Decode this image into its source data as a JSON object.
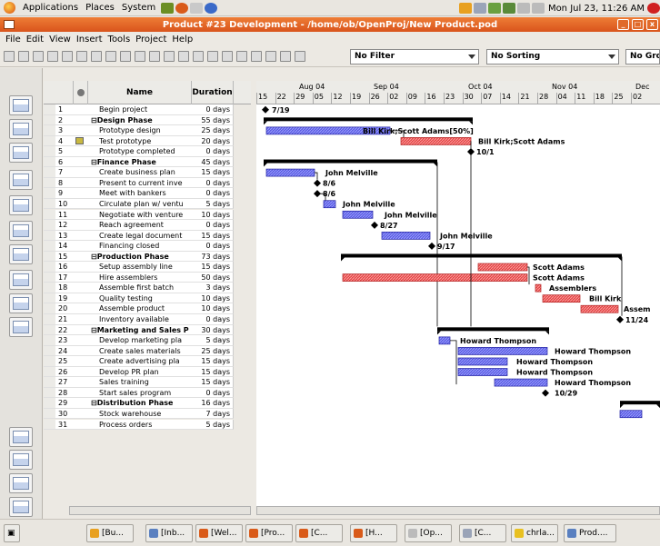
{
  "topbar": {
    "applications": "Applications",
    "places": "Places",
    "system": "System",
    "clock": "Mon Jul 23, 11:26 AM"
  },
  "window": {
    "title": "Product #23 Development - /home/ob/OpenProj/New Product.pod"
  },
  "menu": [
    "File",
    "Edit",
    "View",
    "Insert",
    "Tools",
    "Project",
    "Help"
  ],
  "toolbar": {
    "filter": "No Filter",
    "sorting": "No Sorting",
    "group": "No Grou"
  },
  "table": {
    "col_name": "Name",
    "col_duration": "Duration",
    "rows": [
      {
        "id": "1",
        "name": "Begin project",
        "dur": "0 days"
      },
      {
        "id": "2",
        "name": "⊟Design Phase",
        "dur": "55 days",
        "sum": true
      },
      {
        "id": "3",
        "name": "Prototype design",
        "dur": "25 days"
      },
      {
        "id": "4",
        "name": "Test prototype",
        "dur": "20 days",
        "note": true
      },
      {
        "id": "5",
        "name": "Prototype completed",
        "dur": "0 days"
      },
      {
        "id": "6",
        "name": "⊟Finance Phase",
        "dur": "45 days",
        "sum": true
      },
      {
        "id": "7",
        "name": "Create business plan",
        "dur": "15 days"
      },
      {
        "id": "8",
        "name": "Present to current inve",
        "dur": "0 days"
      },
      {
        "id": "9",
        "name": "Meet with bankers",
        "dur": "0 days"
      },
      {
        "id": "10",
        "name": "Circulate plan w/ ventu",
        "dur": "5 days"
      },
      {
        "id": "11",
        "name": "Negotiate with venture",
        "dur": "10 days"
      },
      {
        "id": "12",
        "name": "Reach agreement",
        "dur": "0 days"
      },
      {
        "id": "13",
        "name": "Create legal document",
        "dur": "15 days"
      },
      {
        "id": "14",
        "name": "Financing closed",
        "dur": "0 days"
      },
      {
        "id": "15",
        "name": "⊟Production Phase",
        "dur": "73 days",
        "sum": true
      },
      {
        "id": "16",
        "name": "Setup assembly line",
        "dur": "15 days"
      },
      {
        "id": "17",
        "name": "Hire assemblers",
        "dur": "50 days"
      },
      {
        "id": "18",
        "name": "Assemble first batch",
        "dur": "3 days"
      },
      {
        "id": "19",
        "name": "Quality testing",
        "dur": "10 days"
      },
      {
        "id": "20",
        "name": "Assemble product",
        "dur": "10 days"
      },
      {
        "id": "21",
        "name": "Inventory available",
        "dur": "0 days"
      },
      {
        "id": "22",
        "name": "⊟Marketing and Sales P",
        "dur": "30 days",
        "sum": true
      },
      {
        "id": "23",
        "name": "Develop marketing pla",
        "dur": "5 days"
      },
      {
        "id": "24",
        "name": "Create sales materials",
        "dur": "25 days"
      },
      {
        "id": "25",
        "name": "Create advertising pla",
        "dur": "15 days"
      },
      {
        "id": "26",
        "name": "Develop PR plan",
        "dur": "15 days"
      },
      {
        "id": "27",
        "name": "Sales training",
        "dur": "15 days"
      },
      {
        "id": "28",
        "name": "Start sales program",
        "dur": "0 days"
      },
      {
        "id": "29",
        "name": "⊟Distribution Phase",
        "dur": "16 days",
        "sum": true
      },
      {
        "id": "30",
        "name": "Stock warehouse",
        "dur": "7 days"
      },
      {
        "id": "31",
        "name": "Process orders",
        "dur": "5 days"
      }
    ]
  },
  "gantt": {
    "months": [
      {
        "label": "Aug 04"
      },
      {
        "label": "Sep 04"
      },
      {
        "label": "Oct 04"
      },
      {
        "label": "Nov 04"
      },
      {
        "label": "Dec"
      }
    ],
    "weeks": [
      "15",
      "22",
      "29",
      "05",
      "12",
      "19",
      "26",
      "02",
      "09",
      "16",
      "23",
      "30",
      "07",
      "14",
      "21",
      "28",
      "04",
      "11",
      "18",
      "25",
      "02"
    ],
    "labels": {
      "m1": "7/19",
      "r3": "Bill Kirk;Scott Adams[50%]",
      "r4": "Bill Kirk;Scott Adams",
      "m5": "10/1",
      "r7": "John Melville",
      "m8": "8/6",
      "m9": "8/6",
      "r10": "John Melville",
      "r11": "John Melville",
      "m12": "8/27",
      "r13": "John Melville",
      "m14": "9/17",
      "r16": "Scott Adams",
      "r17": "Scott Adams",
      "r18": "Assemblers",
      "r19": "Bill Kirk",
      "r20": "Assem",
      "m21": "11/24",
      "r23": "Howard Thompson",
      "r24": "Howard Thompson",
      "r25": "Howard Thompson",
      "r26": "Howard Thompson",
      "r27": "Howard Thompson",
      "m28": "10/29"
    }
  },
  "taskbar": [
    "[Bu...",
    "[Inb...",
    "[Wel...",
    "[Pro...",
    "[C...",
    "[H...",
    "[Op...",
    "[C...",
    "chrla...",
    "Prod...."
  ],
  "colors": {
    "title": "#e0621e",
    "task_blue": "#3a3acc",
    "task_red": "#e85050",
    "summary": "#000000"
  }
}
